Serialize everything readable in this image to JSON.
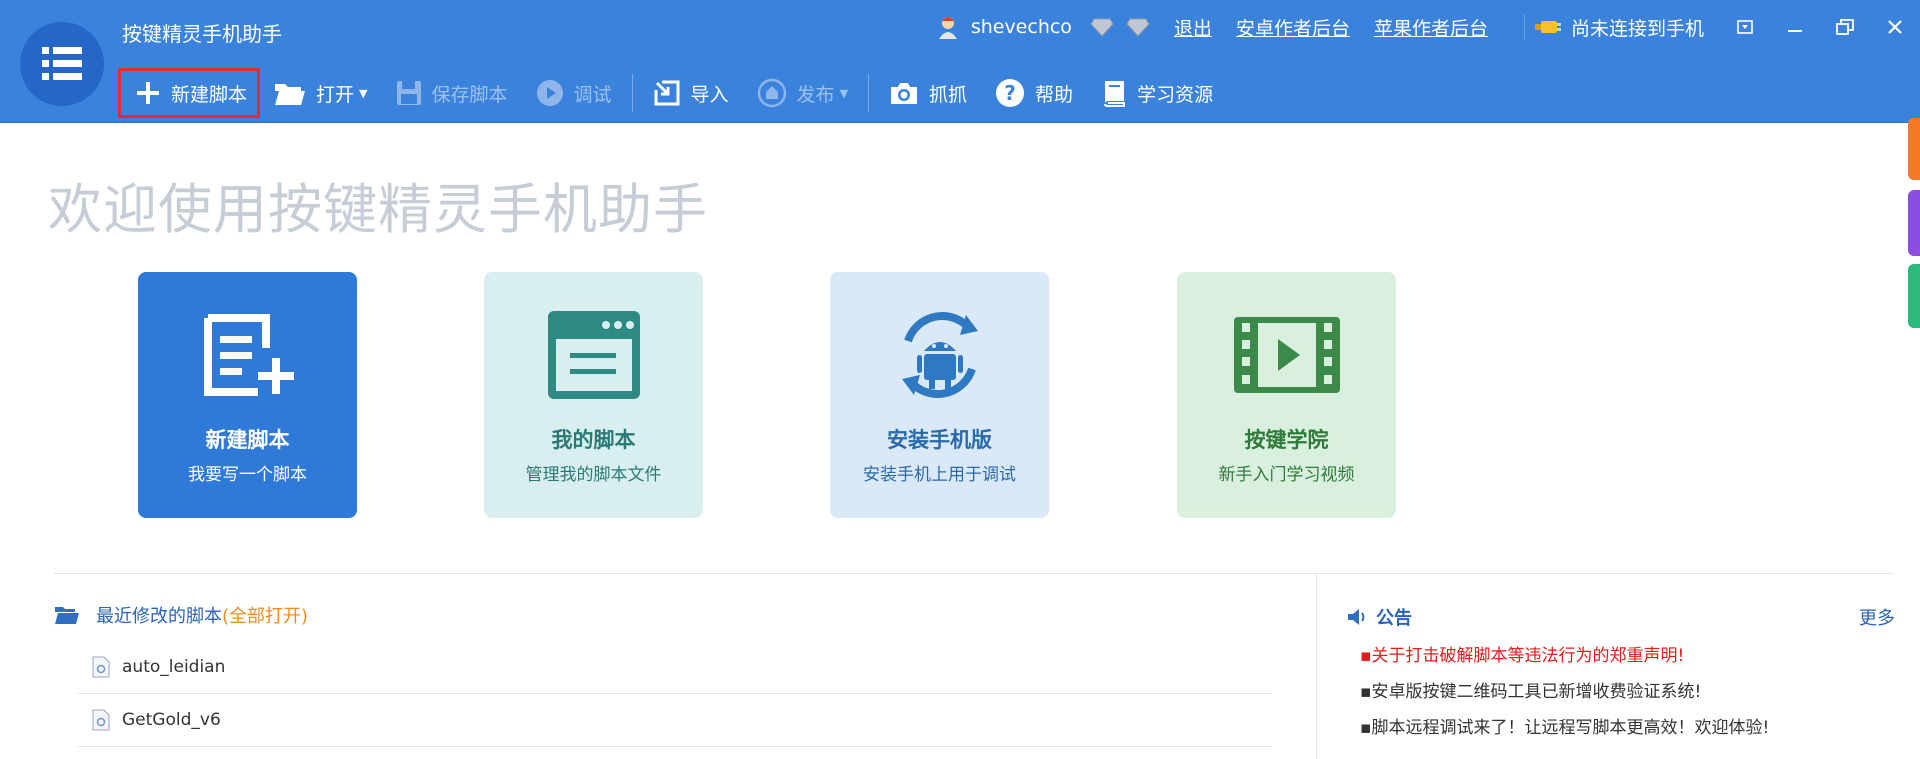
{
  "app": {
    "title": "按键精灵手机助手",
    "menu_icon": "hamburger-menu-icon"
  },
  "user": {
    "name": "shevechco",
    "logout": "退出",
    "android_backend": "安卓作者后台",
    "apple_backend": "苹果作者后台",
    "connection_status": "尚未连接到手机"
  },
  "toolbar": {
    "new_script": "新建脚本",
    "open": "打开",
    "save_script": "保存脚本",
    "debug": "调试",
    "import": "导入",
    "publish": "发布",
    "capture": "抓抓",
    "help": "帮助",
    "learning": "学习资源"
  },
  "welcome": {
    "heading": "欢迎使用按键精灵手机助手"
  },
  "cards": [
    {
      "title": "新建脚本",
      "subtitle": "我要写一个脚本"
    },
    {
      "title": "我的脚本",
      "subtitle": "管理我的脚本文件"
    },
    {
      "title": "安装手机版",
      "subtitle": "安装手机上用于调试"
    },
    {
      "title": "按键学院",
      "subtitle": "新手入门学习视频"
    }
  ],
  "recent": {
    "label": "最近修改的脚本",
    "open_all": "(全部打开)",
    "items": [
      "auto_leidian",
      "GetGold_v6"
    ]
  },
  "notices": {
    "label": "公告",
    "more": "更多",
    "items": [
      "关于打击破解脚本等违法行为的郑重声明!",
      "安卓版按键二维码工具已新增收费验证系统!",
      "脚本远程调试来了！让远程写脚本更高效！欢迎体验!"
    ]
  },
  "colors": {
    "header_blue": "#3b82dc",
    "card_new": "#2f7ad9",
    "card_my_scripts": "#d9efef",
    "card_install": "#d9e9f8",
    "card_academy": "#d9f0de",
    "notice_red": "#e21b1b",
    "highlight_red": "#e02d2d",
    "side_tabs": [
      "#f47a2a",
      "#8a4ee0",
      "#2dbb7c"
    ]
  }
}
